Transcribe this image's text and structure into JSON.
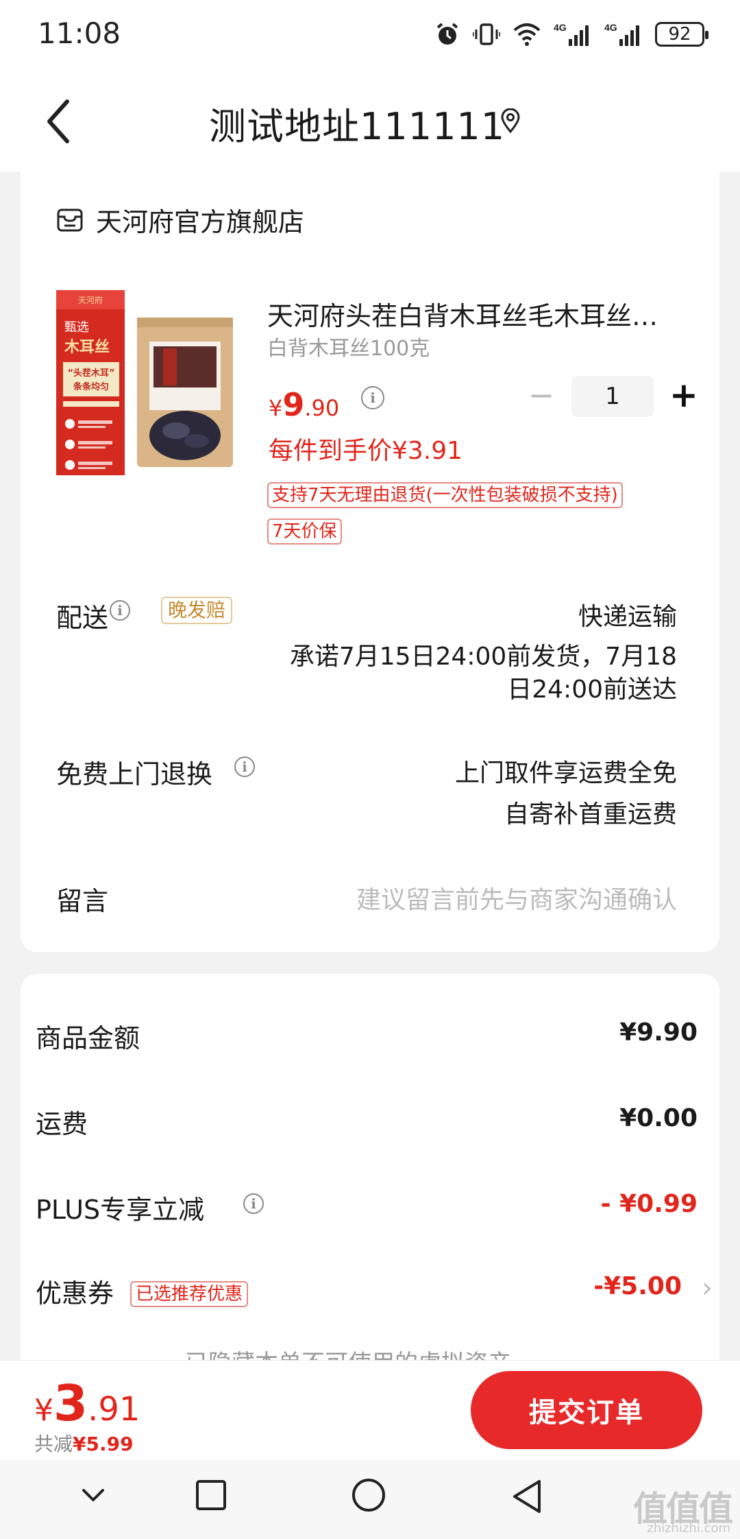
{
  "status_bar": {
    "time": "11:08",
    "battery": "92"
  },
  "nav": {
    "address": "测试地址111111"
  },
  "shop": {
    "name": "天河府官方旗舰店"
  },
  "product": {
    "title": "天河府头茬白背木耳丝毛木耳丝…",
    "spec": "白背木耳丝100克",
    "price_currency": "¥",
    "price_int": "9",
    "price_dec": ".90",
    "final_price": "每件到手价¥3.91",
    "quantity": "1",
    "tag_return": "支持7天无理由退货(一次性包装破损不支持)",
    "tag_price_protect": "7天价保",
    "image_text": {
      "brand": "天河府",
      "top": "甄选",
      "name": "木耳丝",
      "quote": "“头茬木耳”",
      "sub": "条条均匀"
    }
  },
  "delivery": {
    "label": "配送",
    "badge": "晚发赔",
    "method": "快递运输",
    "promise_line1": "承诺7月15日24:00前发货，7月18",
    "promise_line2": "日24:00前送达"
  },
  "return_service": {
    "label": "免费上门退换",
    "line1": "上门取件享运费全免",
    "line2": "自寄补首重运费"
  },
  "message": {
    "label": "留言",
    "placeholder": "建议留言前先与商家沟通确认"
  },
  "summary": {
    "goods_label": "商品金额",
    "goods_value": "¥9.90",
    "shipping_label": "运费",
    "shipping_value": "¥0.00",
    "plus_label": "PLUS专享立减",
    "plus_value": "- ¥0.99",
    "coupon_label": "优惠券",
    "coupon_badge": "已选推荐优惠",
    "coupon_value": "-¥5.00",
    "hidden_assets": "已隐藏本单不可使用的虚拟资产"
  },
  "bottom": {
    "total_currency": "¥",
    "total_int": "3",
    "total_dec": ".91",
    "saved_label": "共减",
    "saved_amount": "¥5.99",
    "submit_label": "提交订单"
  },
  "watermark": {
    "main": "值值值",
    "domain": "zhizhizhi.com"
  },
  "colors": {
    "accent_red": "#e1251b",
    "submit_button": "#e8292a",
    "late_badge": "#c6892d"
  }
}
